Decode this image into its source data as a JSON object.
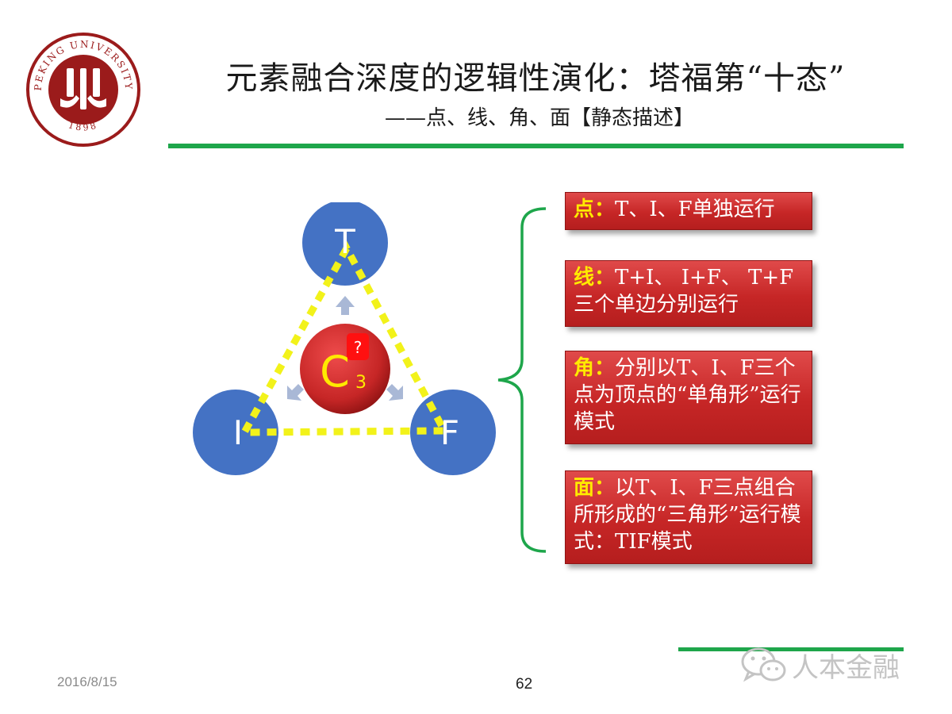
{
  "header": {
    "logo_text": "PEKING UNIVERSITY",
    "logo_year": "1898",
    "title": "元素融合深度的逻辑性演化：塔福第“十态”",
    "subtitle": "——点、线、角、面【静态描述】"
  },
  "diagram": {
    "node_top": "T",
    "node_left": "I",
    "node_right": "F",
    "center_label": "C",
    "center_sub": "3",
    "center_badge": "?",
    "colors": {
      "node": "#4472c4",
      "triangle": "#f2f21a",
      "center": "#c62626",
      "center_text": "#ffea00"
    }
  },
  "boxes": [
    {
      "key": "点",
      "colon": "：",
      "text": "T、I、F单独运行"
    },
    {
      "key": "线",
      "colon": "：",
      "text": "T+I、 I+F、 T+F 三个单边分别运行"
    },
    {
      "key": "角",
      "colon": "：",
      "text": "分别以T、I、F三个点为顶点的“单角形”运行模式"
    },
    {
      "key": "面",
      "colon": "：",
      "text": "以T、I、F三点组合所形成的“三角形”运行模式：TIF模式"
    }
  ],
  "footer": {
    "date": "2016/8/15",
    "page_number": "62",
    "watermark": "人本金融",
    "watermark_icon": "wechat-icon"
  }
}
